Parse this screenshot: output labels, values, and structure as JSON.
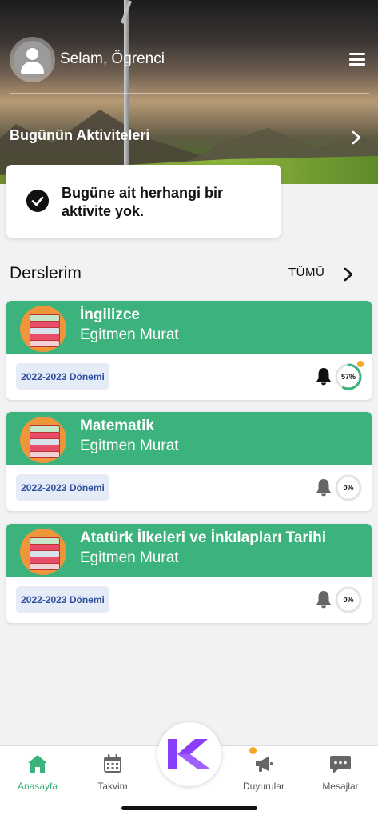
{
  "header": {
    "greeting": "Selam, Ögrenci",
    "activities_title": "Bugünün Aktiviteleri"
  },
  "activity": {
    "empty_message": "Bugüne ait herhangi bir aktivite yok."
  },
  "courses": {
    "title": "Derslerim",
    "all_label": "TÜMÜ",
    "items": [
      {
        "name": "İngilizce",
        "teacher": "Egitmen Murat",
        "term": "2022-2023 Dönemi",
        "progress": 57,
        "progress_label": "57%"
      },
      {
        "name": "Matematik",
        "teacher": "Egitmen Murat",
        "term": "2022-2023 Dönemi",
        "progress": 0,
        "progress_label": "0%"
      },
      {
        "name": "Atatürk İlkeleri ve İnkılapları Tarihi",
        "teacher": "Egitmen Murat",
        "term": "2022-2023 Dönemi",
        "progress": 0,
        "progress_label": "0%"
      }
    ]
  },
  "nav": {
    "items": [
      {
        "label": "Anasayfa",
        "icon": "home-icon",
        "active": true
      },
      {
        "label": "Takvim",
        "icon": "calendar-icon",
        "active": false
      },
      {
        "label": "Duyurular",
        "icon": "megaphone-icon",
        "active": false
      },
      {
        "label": "Mesajlar",
        "icon": "chat-icon",
        "active": false
      }
    ],
    "center_icon": "k-logo-icon"
  },
  "colors": {
    "accent_green": "#3cb27c",
    "badge_text": "#2d4d9d",
    "notification_dot": "#f5a623",
    "logo_purple": "#8a3ffc"
  }
}
